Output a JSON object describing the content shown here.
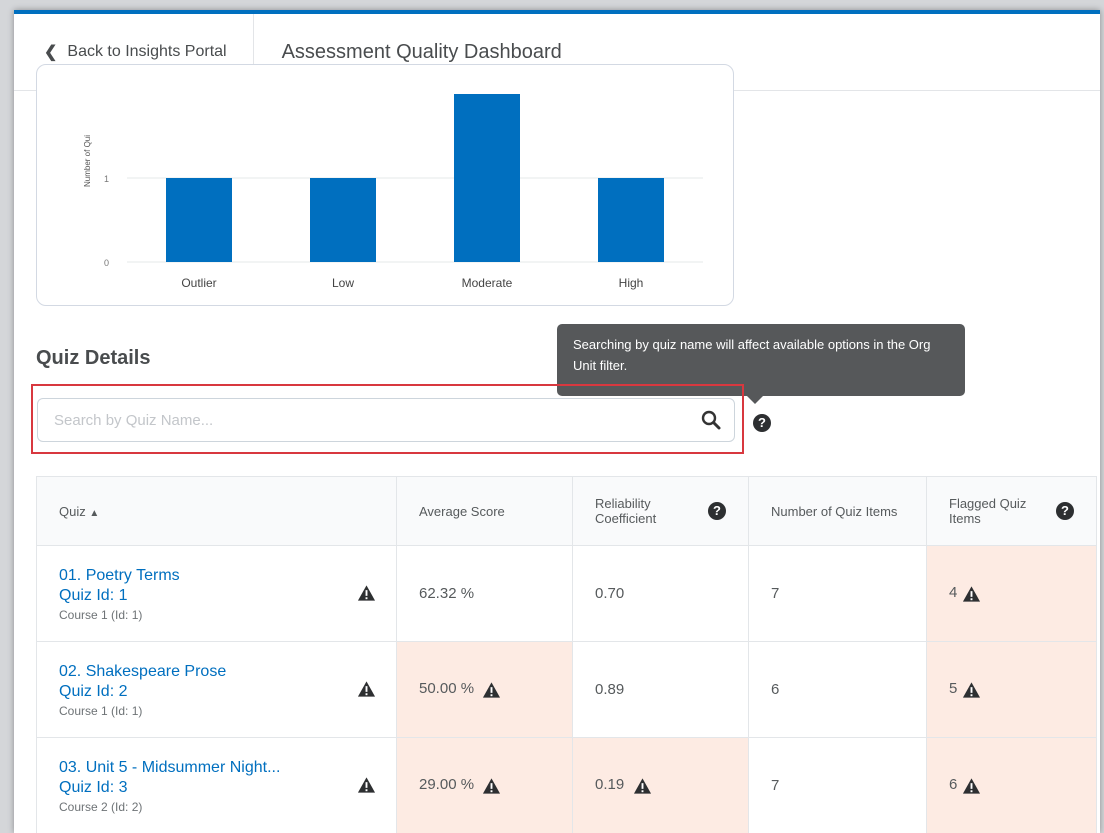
{
  "header": {
    "back_label": "Back to Insights Portal",
    "title": "Assessment Quality Dashboard"
  },
  "chart_data": {
    "type": "bar",
    "categories": [
      "Outlier",
      "Low",
      "Moderate",
      "High"
    ],
    "values": [
      1,
      1,
      2,
      1
    ],
    "ylabel": "Number of Quizzes",
    "ylabel_visible": "Number of Qui",
    "ylim": [
      0,
      2
    ],
    "yticks": [
      0,
      1
    ],
    "grid": true,
    "bar_color": "#006fbf"
  },
  "quiz_details": {
    "title": "Quiz Details",
    "search_placeholder": "Search by Quiz Name...",
    "tooltip": "Searching by quiz name will affect available options in the Org Unit filter.",
    "columns": [
      {
        "label": "Quiz",
        "sort": "ascending"
      },
      {
        "label": "Average Score"
      },
      {
        "label": "Reliability Coefficient",
        "help": true
      },
      {
        "label": "Number of Quiz Items"
      },
      {
        "label": "Flagged Quiz Items",
        "help": true
      }
    ],
    "rows": [
      {
        "name": "01. Poetry Terms",
        "quiz_id": "Quiz Id: 1",
        "course": "Course 1 (Id: 1)",
        "avg_score": "62.32 %",
        "avg_flag": false,
        "reliability": "0.70",
        "rel_flag": false,
        "num_items": "7",
        "flagged_items": "4"
      },
      {
        "name": "02. Shakespeare Prose",
        "quiz_id": "Quiz Id: 2",
        "course": "Course 1 (Id: 1)",
        "avg_score": "50.00 %",
        "avg_flag": true,
        "reliability": "0.89",
        "rel_flag": false,
        "num_items": "6",
        "flagged_items": "5"
      },
      {
        "name": "03. Unit 5 - Midsummer Night...",
        "quiz_id": "Quiz Id: 3",
        "course": "Course 2 (Id: 2)",
        "avg_score": "29.00 %",
        "avg_flag": true,
        "reliability": "0.19",
        "rel_flag": true,
        "num_items": "7",
        "flagged_items": "6"
      }
    ],
    "warning_icon": "warning-triangle-icon",
    "flag_color": "#fdebe3"
  }
}
